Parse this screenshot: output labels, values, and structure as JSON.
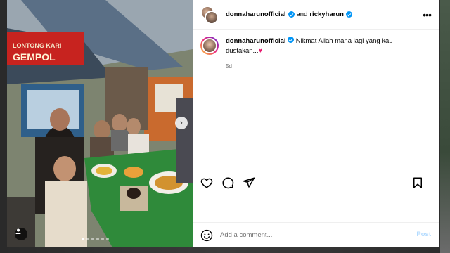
{
  "header": {
    "user1": "donnaharunofficial",
    "joiner": "and",
    "user2": "rickyharun",
    "more_icon": "more-horizontal-icon"
  },
  "caption": {
    "username": "donnaharunofficial",
    "text": "Nikmat Allah mana lagi yang kau dustakan...",
    "emoji": "♥",
    "time": "5d"
  },
  "photo": {
    "sign_text": "LONTONG KARI",
    "sign_text2": "GEMPOL",
    "nav_next_icon": "chevron-right-icon",
    "tag_icon": "user-tag-icon",
    "dot_count": 6,
    "active_dot": 0
  },
  "actions": {
    "like_icon": "heart-icon",
    "comment_icon": "comment-icon",
    "share_icon": "share-icon",
    "save_icon": "bookmark-icon"
  },
  "comment": {
    "placeholder": "Add a comment...",
    "post_label": "Post",
    "emoji_icon": "smiley-icon"
  },
  "colors": {
    "verified": "#0095f6",
    "post_disabled": "#b3dbff",
    "heart": "#e6196e"
  }
}
